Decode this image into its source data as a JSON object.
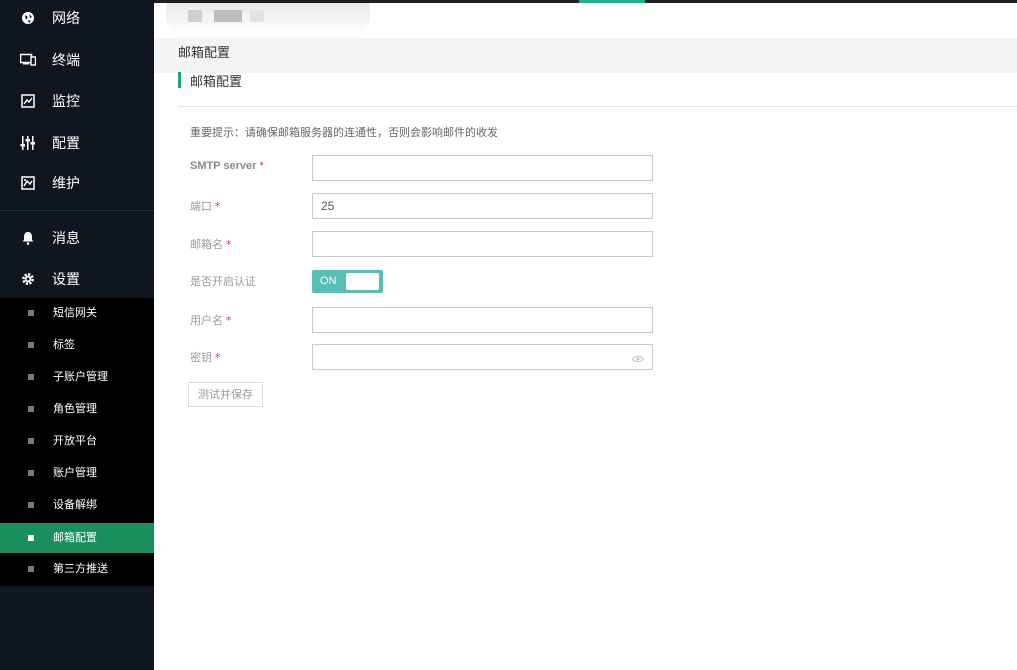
{
  "sidebar": {
    "main_items": [
      {
        "label": "网络",
        "icon": "globe-icon"
      },
      {
        "label": "终端",
        "icon": "devices-icon"
      },
      {
        "label": "监控",
        "icon": "monitor-icon"
      },
      {
        "label": "配置",
        "icon": "sliders-icon"
      },
      {
        "label": "维护",
        "icon": "maintenance-icon"
      }
    ],
    "secondary_items": [
      {
        "label": "消息",
        "icon": "bell-icon"
      },
      {
        "label": "设置",
        "icon": "gear-icon"
      }
    ],
    "settings_sub_items": [
      {
        "label": "短信网关"
      },
      {
        "label": "标签"
      },
      {
        "label": "子账户管理"
      },
      {
        "label": "角色管理"
      },
      {
        "label": "开放平台"
      },
      {
        "label": "账户管理"
      },
      {
        "label": "设备解绑"
      },
      {
        "label": "邮箱配置",
        "active": true
      },
      {
        "label": "第三方推送"
      }
    ]
  },
  "breadcrumb": {
    "label": "邮箱配置"
  },
  "section": {
    "title": "邮箱配置"
  },
  "form": {
    "notice": "重要提示：请确保邮箱服务器的连通性，否则会影响邮件的收发",
    "smtp_label": "SMTP server",
    "smtp_value": "",
    "port_label": "端口",
    "port_value": "25",
    "email_label": "邮箱名",
    "email_value": "",
    "auth_label": "是否开启认证",
    "auth_toggle": "ON",
    "username_label": "用户名",
    "username_value": "",
    "password_label": "密钥",
    "password_value": "",
    "required_mark": "*",
    "submit_label": "测试并保存"
  },
  "colors": {
    "sidebar_bg": "#0f1620",
    "accent_green": "#1a8f5e",
    "toggle_on": "#59bfb5",
    "required": "#e0353b"
  }
}
